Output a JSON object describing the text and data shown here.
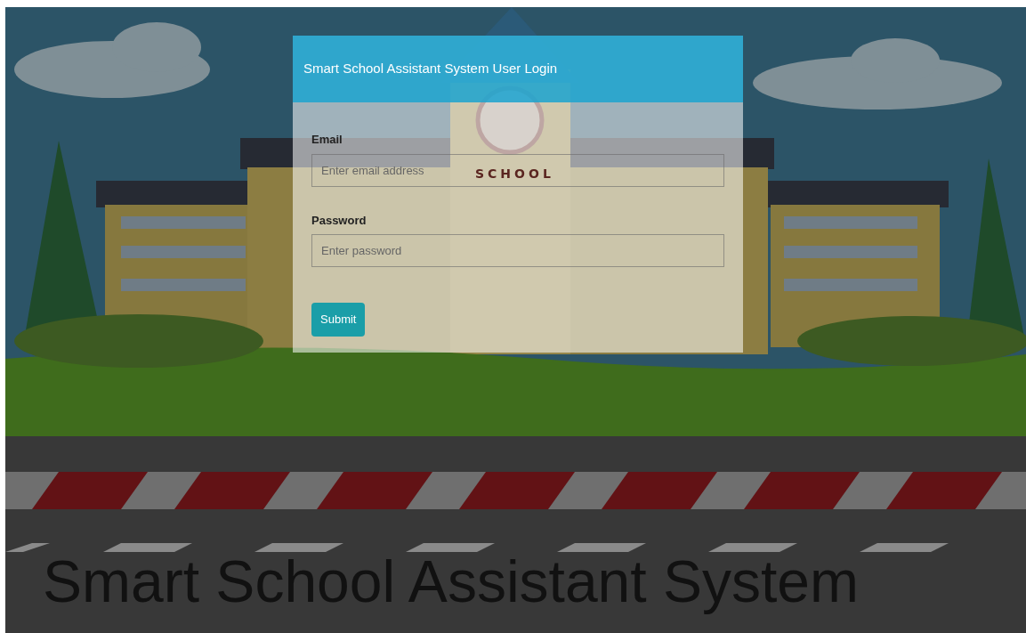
{
  "login": {
    "title": "Smart School Assistant System User Login",
    "fields": [
      {
        "label": "Email",
        "placeholder": "Enter email address"
      },
      {
        "label": "Password",
        "placeholder": "Enter password"
      }
    ],
    "submit": "Submit"
  },
  "background": {
    "sign": "SCHOOL",
    "caption": "Smart School Assistant System"
  }
}
